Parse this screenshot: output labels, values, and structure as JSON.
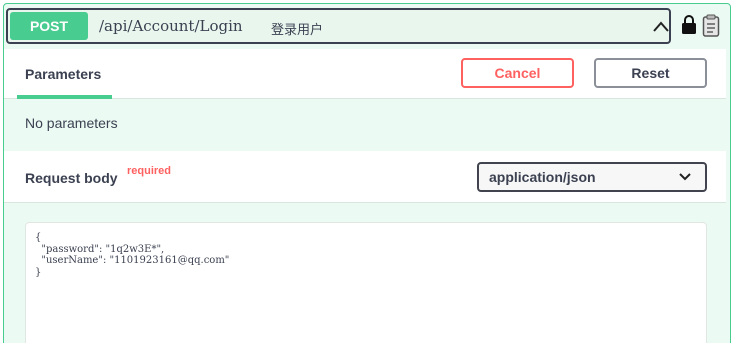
{
  "summary": {
    "method": "POST",
    "path": "/api/Account/Login",
    "description": "登录用户"
  },
  "params_tab": {
    "label": "Parameters",
    "cancel_label": "Cancel",
    "reset_label": "Reset",
    "empty_text": "No parameters"
  },
  "request_body": {
    "label": "Request body",
    "required_label": "required",
    "content_type": "application/json",
    "json_lines": [
      "{",
      "  \"password\": \"1q2w3E*\",",
      "  \"userName\": \"1101923161@qq.com\"",
      "}"
    ]
  },
  "colors": {
    "accent": "#49cc90",
    "danger": "#ff6060",
    "text": "#3b4151"
  },
  "icons": [
    "chevron-up-icon",
    "lock-icon",
    "clipboard-icon",
    "chevron-down-icon"
  ]
}
